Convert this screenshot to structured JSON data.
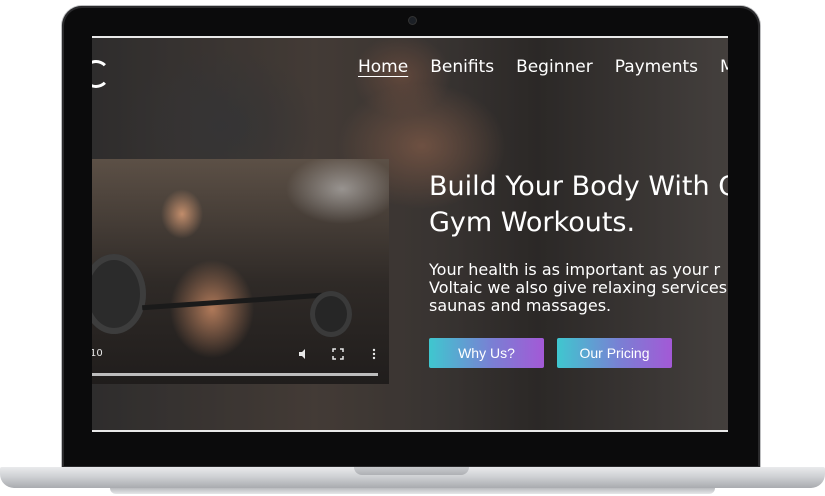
{
  "nav": {
    "items": [
      {
        "label": "Home",
        "active": true
      },
      {
        "label": "Benifits"
      },
      {
        "label": "Beginner"
      },
      {
        "label": "Payments"
      },
      {
        "label": "M"
      }
    ]
  },
  "hero": {
    "headline_line1": "Build Your Body With Ou",
    "headline_line2": "Gym Workouts.",
    "body_line1": "Your health is as important as your r",
    "body_line2": "Voltaic we also give relaxing services",
    "body_line3": "saunas and massages."
  },
  "video": {
    "time": "10",
    "controls": [
      "volume-icon",
      "fullscreen-icon",
      "more-options-icon"
    ]
  },
  "buttons": {
    "why_us": "Why Us?",
    "our_pricing": "Our Pricing"
  },
  "colors": {
    "button_gradient_start": "#3fc7cf",
    "button_gradient_end": "#a359d6"
  }
}
